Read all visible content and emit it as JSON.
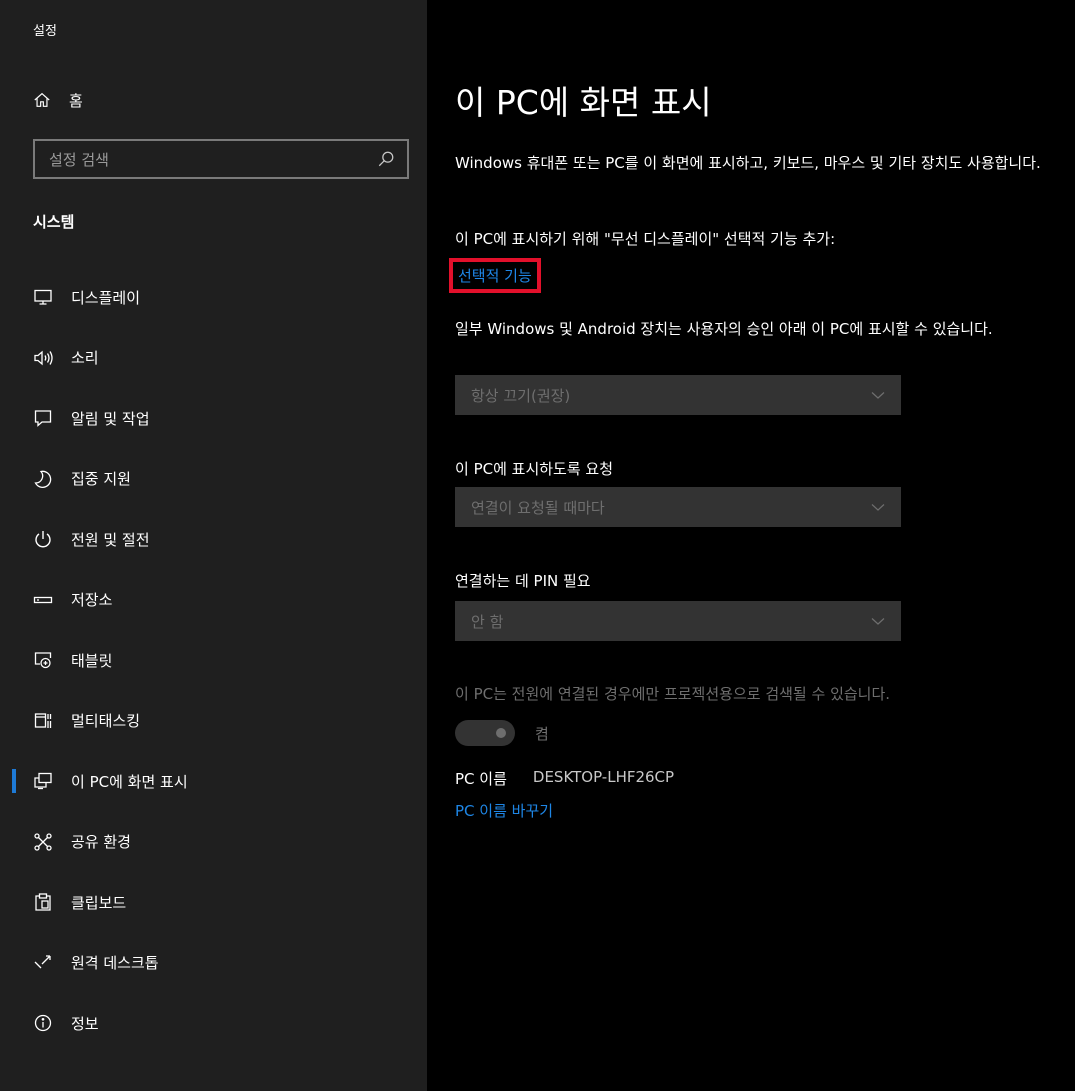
{
  "window": {
    "title": "설정"
  },
  "sidebar": {
    "home_label": "홈",
    "search_placeholder": "설정 검색",
    "section_heading": "시스템",
    "items": [
      {
        "label": "디스플레이",
        "icon": "monitor-icon"
      },
      {
        "label": "소리",
        "icon": "speaker-icon"
      },
      {
        "label": "알림 및 작업",
        "icon": "notification-icon"
      },
      {
        "label": "집중 지원",
        "icon": "moon-icon"
      },
      {
        "label": "전원 및 절전",
        "icon": "power-icon"
      },
      {
        "label": "저장소",
        "icon": "storage-icon"
      },
      {
        "label": "태블릿",
        "icon": "tablet-icon"
      },
      {
        "label": "멀티태스킹",
        "icon": "multitasking-icon"
      },
      {
        "label": "이 PC에 화면 표시",
        "icon": "project-icon",
        "active": true
      },
      {
        "label": "공유 환경",
        "icon": "shared-experiences-icon"
      },
      {
        "label": "클립보드",
        "icon": "clipboard-icon"
      },
      {
        "label": "원격 데스크톱",
        "icon": "remote-desktop-icon"
      },
      {
        "label": "정보",
        "icon": "info-icon"
      }
    ]
  },
  "main": {
    "title": "이 PC에 화면 표시",
    "description": "Windows 휴대폰 또는 PC를 이 화면에 표시하고, 키보드, 마우스 및 기타 장치도 사용합니다.",
    "feature_text": "이 PC에 표시하기 위해 \"무선 디스플레이\" 선택적 기능 추가:",
    "feature_link": "선택적 기능",
    "device_text": "일부 Windows 및 Android 장치는 사용자의 승인 아래 이 PC에 표시할 수 있습니다.",
    "dropdown1_value": "항상 끄기(권장)",
    "request_label": "이 PC에 표시하도록 요청",
    "dropdown2_value": "연결이 요청될 때마다",
    "pin_label": "연결하는 데 PIN 필요",
    "dropdown3_value": "안 함",
    "power_note": "이 PC는 전원에 연결된 경우에만 프로젝션용으로 검색될 수 있습니다.",
    "toggle_label": "켬",
    "pc_name_label": "PC 이름",
    "pc_name_value": "DESKTOP-LHF26CP",
    "rename_link": "PC 이름 바꾸기"
  },
  "colors": {
    "sidebar_bg": "#1f1f1f",
    "main_bg": "#000000",
    "accent": "#1e7ad6",
    "link": "#1e86e6",
    "highlight_box": "#e3102b",
    "disabled_text": "#6e6e6e"
  }
}
